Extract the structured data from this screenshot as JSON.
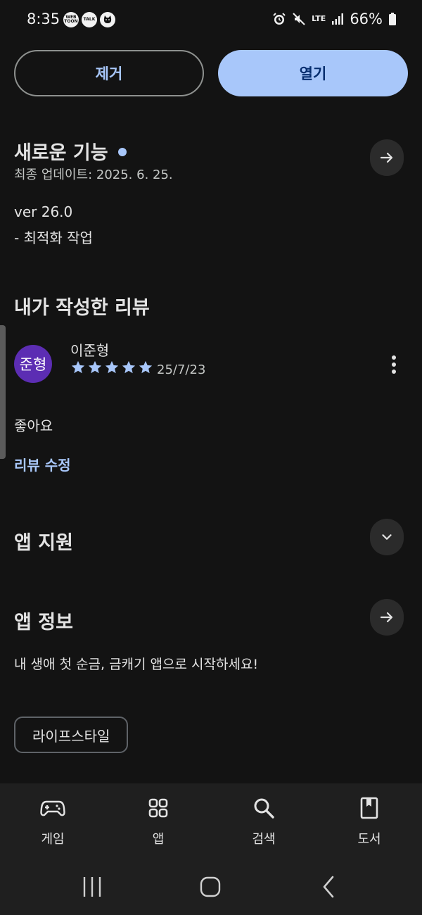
{
  "status_bar": {
    "time": "8:35",
    "notifications": [
      "WEB TOON",
      "TALK",
      "cat-icon"
    ],
    "battery": "66%",
    "network": "LTE"
  },
  "actions": {
    "remove_label": "제거",
    "open_label": "열기"
  },
  "whats_new": {
    "title": "새로운 기능",
    "updated": "최종 업데이트: 2025. 6. 25.",
    "version": "ver 26.0",
    "notes": "- 최적화 작업"
  },
  "my_review": {
    "title": "내가 작성한 리뷰",
    "avatar_text": "준형",
    "author": "이준형",
    "rating": 5,
    "date": "25/7/23",
    "text": "좋아요",
    "edit_label": "리뷰 수정"
  },
  "app_support": {
    "title": "앱 지원"
  },
  "app_info": {
    "title": "앱 정보",
    "description": "내 생애 첫 순금, 금캐기 앱으로 시작하세요!",
    "category": "라이프스타일"
  },
  "bottom_nav": {
    "items": [
      {
        "label": "게임",
        "icon": "gamepad-icon"
      },
      {
        "label": "앱",
        "icon": "apps-grid-icon"
      },
      {
        "label": "검색",
        "icon": "search-icon"
      },
      {
        "label": "도서",
        "icon": "book-icon"
      }
    ]
  },
  "colors": {
    "accent": "#a8c7fa",
    "background": "#131313",
    "avatar": "#5c2db3"
  }
}
